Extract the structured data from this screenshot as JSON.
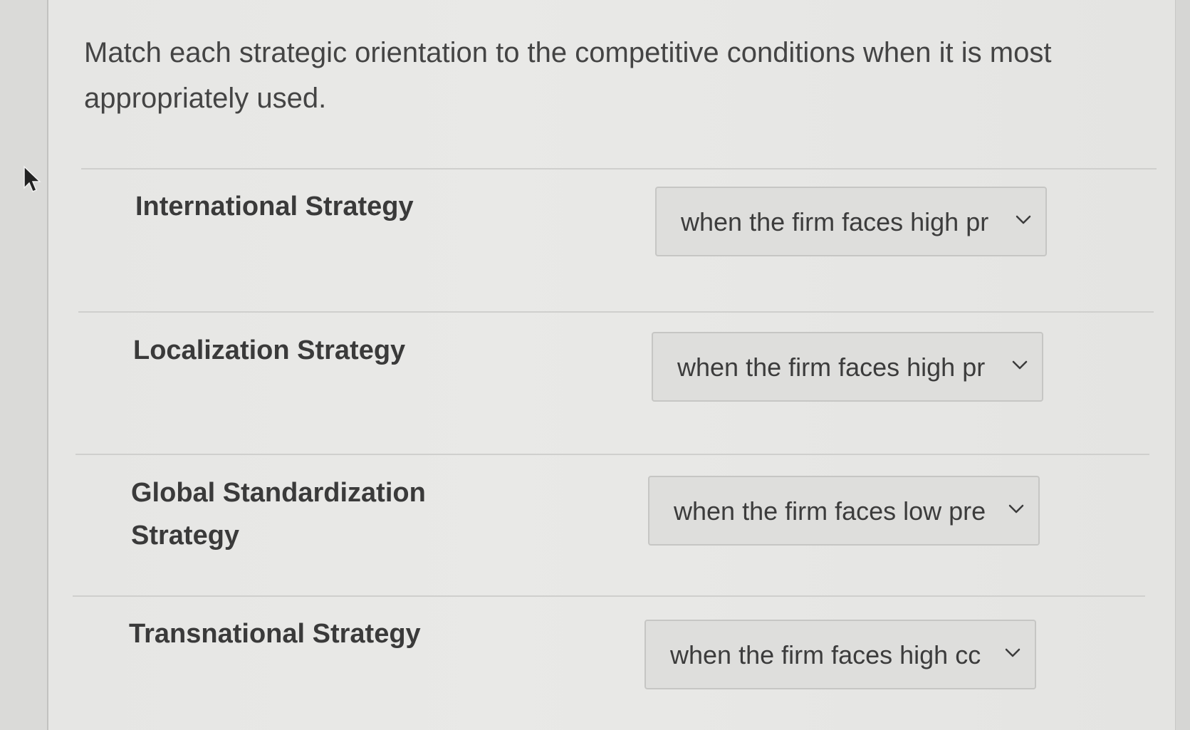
{
  "question": {
    "text": "Match each strategic orientation to the competitive conditions when it is most appropriately used."
  },
  "rows": [
    {
      "label": "International Strategy",
      "selected": "when the firm faces high pr"
    },
    {
      "label": "Localization Strategy",
      "selected": "when the firm faces high pr"
    },
    {
      "label": "Global Standardization Strategy",
      "selected": "when the firm faces low pre"
    },
    {
      "label": "Transnational Strategy",
      "selected": "when the firm faces high cc"
    }
  ],
  "icons": {
    "cursor": "mouse-pointer-icon",
    "dropdown": "chevron-down-icon"
  },
  "colors": {
    "background": "#e6e6e4",
    "text": "#3a3a3a",
    "select_bg": "#dededc",
    "select_border": "#c6c6c4"
  }
}
